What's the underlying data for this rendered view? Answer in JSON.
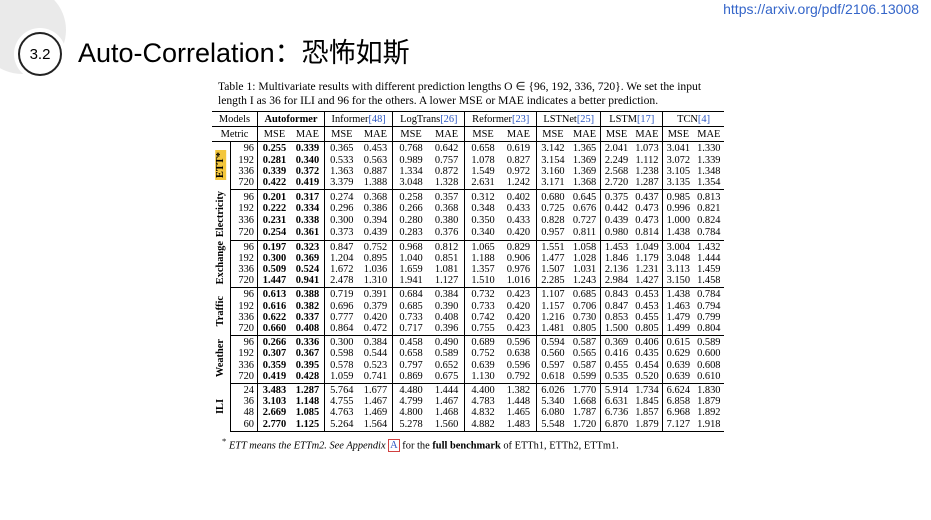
{
  "header": {
    "url": "https://arxiv.org/pdf/2106.13008",
    "section_number": "3.2",
    "title": "Auto-Correlation：恐怖如斯"
  },
  "caption": "Table 1: Multivariate results with different prediction lengths O ∈ {96, 192, 336, 720}. We set the input length I as 36 for ILI and 96 for the others. A lower MSE or MAE indicates a better prediction.",
  "table": {
    "models_label": "Models",
    "metric_label": "Metric",
    "models": [
      {
        "name": "Autoformer",
        "cite": ""
      },
      {
        "name": "Informer",
        "cite": "[48]"
      },
      {
        "name": "LogTrans",
        "cite": "[26]"
      },
      {
        "name": "Reformer",
        "cite": "[23]"
      },
      {
        "name": "LSTNet",
        "cite": "[25]"
      },
      {
        "name": "LSTM",
        "cite": "[17]"
      },
      {
        "name": "TCN",
        "cite": "[4]"
      }
    ],
    "mse": "MSE",
    "mae": "MAE",
    "groups": [
      {
        "dataset": "ETT*",
        "highlight": true,
        "rows": [
          {
            "len": "96",
            "values": [
              "0.255",
              "0.339",
              "0.365",
              "0.453",
              "0.768",
              "0.642",
              "0.658",
              "0.619",
              "3.142",
              "1.365",
              "2.041",
              "1.073",
              "3.041",
              "1.330"
            ]
          },
          {
            "len": "192",
            "values": [
              "0.281",
              "0.340",
              "0.533",
              "0.563",
              "0.989",
              "0.757",
              "1.078",
              "0.827",
              "3.154",
              "1.369",
              "2.249",
              "1.112",
              "3.072",
              "1.339"
            ]
          },
          {
            "len": "336",
            "values": [
              "0.339",
              "0.372",
              "1.363",
              "0.887",
              "1.334",
              "0.872",
              "1.549",
              "0.972",
              "3.160",
              "1.369",
              "2.568",
              "1.238",
              "3.105",
              "1.348"
            ]
          },
          {
            "len": "720",
            "values": [
              "0.422",
              "0.419",
              "3.379",
              "1.388",
              "3.048",
              "1.328",
              "2.631",
              "1.242",
              "3.171",
              "1.368",
              "2.720",
              "1.287",
              "3.135",
              "1.354"
            ]
          }
        ]
      },
      {
        "dataset": "Electricity",
        "highlight": false,
        "rows": [
          {
            "len": "96",
            "values": [
              "0.201",
              "0.317",
              "0.274",
              "0.368",
              "0.258",
              "0.357",
              "0.312",
              "0.402",
              "0.680",
              "0.645",
              "0.375",
              "0.437",
              "0.985",
              "0.813"
            ]
          },
          {
            "len": "192",
            "values": [
              "0.222",
              "0.334",
              "0.296",
              "0.386",
              "0.266",
              "0.368",
              "0.348",
              "0.433",
              "0.725",
              "0.676",
              "0.442",
              "0.473",
              "0.996",
              "0.821"
            ]
          },
          {
            "len": "336",
            "values": [
              "0.231",
              "0.338",
              "0.300",
              "0.394",
              "0.280",
              "0.380",
              "0.350",
              "0.433",
              "0.828",
              "0.727",
              "0.439",
              "0.473",
              "1.000",
              "0.824"
            ]
          },
          {
            "len": "720",
            "values": [
              "0.254",
              "0.361",
              "0.373",
              "0.439",
              "0.283",
              "0.376",
              "0.340",
              "0.420",
              "0.957",
              "0.811",
              "0.980",
              "0.814",
              "1.438",
              "0.784"
            ]
          }
        ]
      },
      {
        "dataset": "Exchange",
        "highlight": false,
        "rows": [
          {
            "len": "96",
            "values": [
              "0.197",
              "0.323",
              "0.847",
              "0.752",
              "0.968",
              "0.812",
              "1.065",
              "0.829",
              "1.551",
              "1.058",
              "1.453",
              "1.049",
              "3.004",
              "1.432"
            ]
          },
          {
            "len": "192",
            "values": [
              "0.300",
              "0.369",
              "1.204",
              "0.895",
              "1.040",
              "0.851",
              "1.188",
              "0.906",
              "1.477",
              "1.028",
              "1.846",
              "1.179",
              "3.048",
              "1.444"
            ]
          },
          {
            "len": "336",
            "values": [
              "0.509",
              "0.524",
              "1.672",
              "1.036",
              "1.659",
              "1.081",
              "1.357",
              "0.976",
              "1.507",
              "1.031",
              "2.136",
              "1.231",
              "3.113",
              "1.459"
            ]
          },
          {
            "len": "720",
            "values": [
              "1.447",
              "0.941",
              "2.478",
              "1.310",
              "1.941",
              "1.127",
              "1.510",
              "1.016",
              "2.285",
              "1.243",
              "2.984",
              "1.427",
              "3.150",
              "1.458"
            ]
          }
        ]
      },
      {
        "dataset": "Traffic",
        "highlight": false,
        "rows": [
          {
            "len": "96",
            "values": [
              "0.613",
              "0.388",
              "0.719",
              "0.391",
              "0.684",
              "0.384",
              "0.732",
              "0.423",
              "1.107",
              "0.685",
              "0.843",
              "0.453",
              "1.438",
              "0.784"
            ]
          },
          {
            "len": "192",
            "values": [
              "0.616",
              "0.382",
              "0.696",
              "0.379",
              "0.685",
              "0.390",
              "0.733",
              "0.420",
              "1.157",
              "0.706",
              "0.847",
              "0.453",
              "1.463",
              "0.794"
            ]
          },
          {
            "len": "336",
            "values": [
              "0.622",
              "0.337",
              "0.777",
              "0.420",
              "0.733",
              "0.408",
              "0.742",
              "0.420",
              "1.216",
              "0.730",
              "0.853",
              "0.455",
              "1.479",
              "0.799"
            ]
          },
          {
            "len": "720",
            "values": [
              "0.660",
              "0.408",
              "0.864",
              "0.472",
              "0.717",
              "0.396",
              "0.755",
              "0.423",
              "1.481",
              "0.805",
              "1.500",
              "0.805",
              "1.499",
              "0.804"
            ]
          }
        ]
      },
      {
        "dataset": "Weather",
        "highlight": false,
        "rows": [
          {
            "len": "96",
            "values": [
              "0.266",
              "0.336",
              "0.300",
              "0.384",
              "0.458",
              "0.490",
              "0.689",
              "0.596",
              "0.594",
              "0.587",
              "0.369",
              "0.406",
              "0.615",
              "0.589"
            ]
          },
          {
            "len": "192",
            "values": [
              "0.307",
              "0.367",
              "0.598",
              "0.544",
              "0.658",
              "0.589",
              "0.752",
              "0.638",
              "0.560",
              "0.565",
              "0.416",
              "0.435",
              "0.629",
              "0.600"
            ]
          },
          {
            "len": "336",
            "values": [
              "0.359",
              "0.395",
              "0.578",
              "0.523",
              "0.797",
              "0.652",
              "0.639",
              "0.596",
              "0.597",
              "0.587",
              "0.455",
              "0.454",
              "0.639",
              "0.608"
            ]
          },
          {
            "len": "720",
            "values": [
              "0.419",
              "0.428",
              "1.059",
              "0.741",
              "0.869",
              "0.675",
              "1.130",
              "0.792",
              "0.618",
              "0.599",
              "0.535",
              "0.520",
              "0.639",
              "0.610"
            ]
          }
        ]
      },
      {
        "dataset": "ILI",
        "highlight": false,
        "rows": [
          {
            "len": "24",
            "values": [
              "3.483",
              "1.287",
              "5.764",
              "1.677",
              "4.480",
              "1.444",
              "4.400",
              "1.382",
              "6.026",
              "1.770",
              "5.914",
              "1.734",
              "6.624",
              "1.830"
            ]
          },
          {
            "len": "36",
            "values": [
              "3.103",
              "1.148",
              "4.755",
              "1.467",
              "4.799",
              "1.467",
              "4.783",
              "1.448",
              "5.340",
              "1.668",
              "6.631",
              "1.845",
              "6.858",
              "1.879"
            ]
          },
          {
            "len": "48",
            "values": [
              "2.669",
              "1.085",
              "4.763",
              "1.469",
              "4.800",
              "1.468",
              "4.832",
              "1.465",
              "6.080",
              "1.787",
              "6.736",
              "1.857",
              "6.968",
              "1.892"
            ]
          },
          {
            "len": "60",
            "values": [
              "2.770",
              "1.125",
              "5.264",
              "1.564",
              "5.278",
              "1.560",
              "4.882",
              "1.483",
              "5.548",
              "1.720",
              "6.870",
              "1.879",
              "7.127",
              "1.918"
            ]
          }
        ]
      }
    ]
  },
  "footnote": {
    "marker": "*",
    "text_1": "ETT means the ETTm2. See Appendix",
    "appendix_ref": "A",
    "text_2": "for the",
    "bold": "full benchmark",
    "text_3": "of ETTh1, ETTh2, ETTm1."
  },
  "colors": {
    "highlight": "#f3c63c",
    "link": "#3465c9"
  }
}
